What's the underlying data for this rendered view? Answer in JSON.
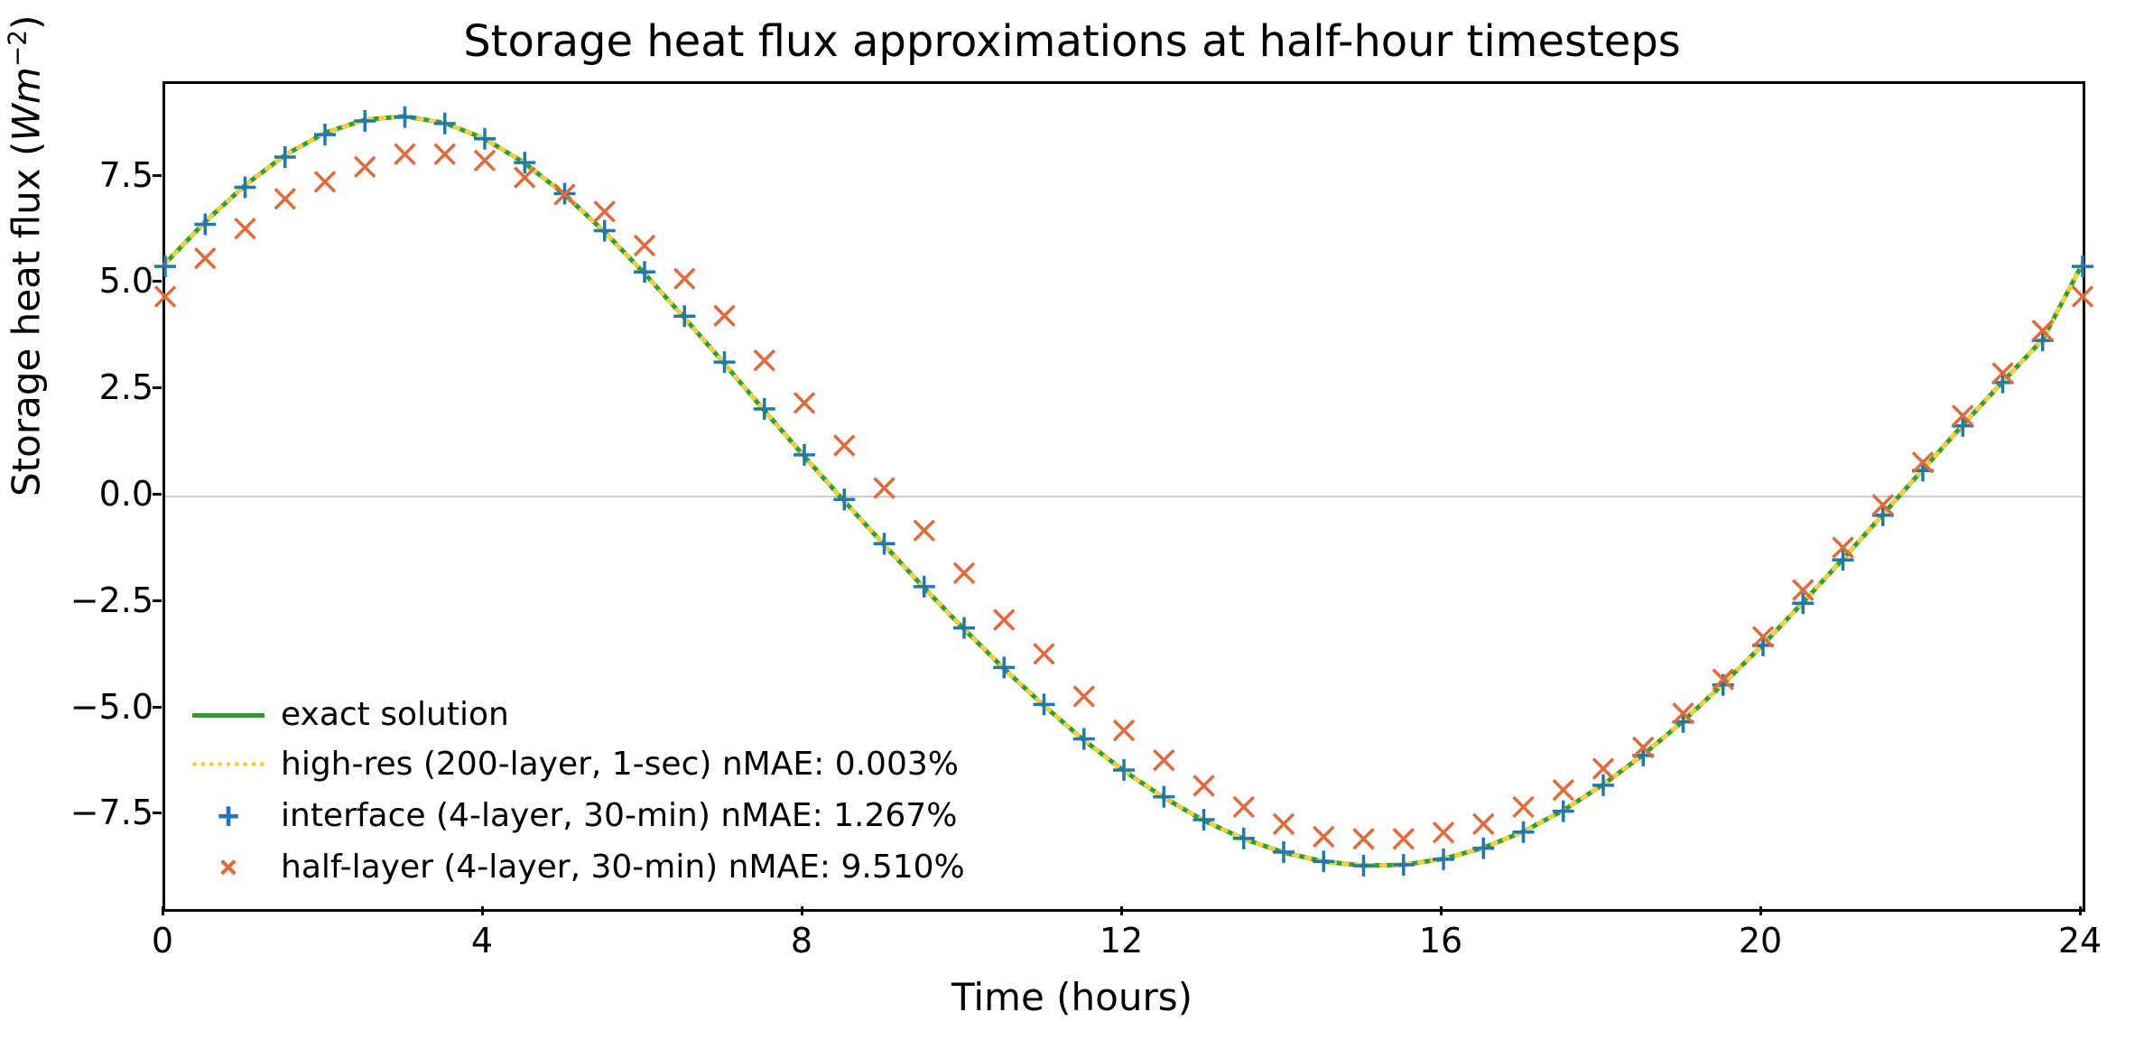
{
  "chart_data": {
    "type": "line",
    "title": "Storage heat flux approximations at half-hour timesteps",
    "xlabel": "Time (hours)",
    "ylabel_html": "Storage heat flux (<span class='mi'>Wm</span><span class='sup'>−2</span>)",
    "xlim": [
      0,
      24
    ],
    "ylim": [
      -9.7,
      9.7
    ],
    "xticks": [
      0,
      4,
      8,
      12,
      16,
      20,
      24
    ],
    "yticks": [
      -7.5,
      -5.0,
      -2.5,
      0.0,
      2.5,
      5.0,
      7.5
    ],
    "ytick_labels": [
      "−7.5",
      "−5.0",
      "−2.5",
      "0.0",
      "2.5",
      "5.0",
      "7.5"
    ],
    "legend_pos": "lower left",
    "series": [
      {
        "name": "exact solution",
        "style": "solid",
        "color": "#2ca02c",
        "smooth": true,
        "x": [
          0,
          0.5,
          1,
          1.5,
          2,
          2.5,
          3,
          3.5,
          4,
          4.5,
          5,
          5.5,
          6,
          6.5,
          7,
          7.5,
          8,
          8.5,
          9,
          9.5,
          10,
          10.5,
          11,
          11.5,
          12,
          12.5,
          13,
          13.5,
          14,
          14.5,
          15,
          15.5,
          16,
          16.5,
          17,
          17.5,
          18,
          18.5,
          19,
          19.5,
          20,
          20.5,
          21,
          21.5,
          22,
          22.5,
          23,
          23.5,
          24
        ],
        "values": [
          5.48,
          6.46,
          7.32,
          8.03,
          8.55,
          8.86,
          8.94,
          8.78,
          8.41,
          7.84,
          7.1,
          6.22,
          5.24,
          4.2,
          3.12,
          2.02,
          0.94,
          -0.11,
          -1.14,
          -2.15,
          -3.12,
          -4.05,
          -4.92,
          -5.73,
          -6.45,
          -7.08,
          -7.62,
          -8.05,
          -8.37,
          -8.58,
          -8.68,
          -8.66,
          -8.52,
          -8.26,
          -7.88,
          -7.38,
          -6.77,
          -6.07,
          -5.28,
          -4.41,
          -3.48,
          -2.49,
          -1.47,
          -0.42,
          0.63,
          1.68,
          2.7,
          3.69,
          5.48
        ]
      },
      {
        "name": "high-res (200-layer, 1-sec)  nMAE: 0.003%",
        "style": "dotted",
        "color": "#f4d13a",
        "smooth": true,
        "x": [
          0,
          0.5,
          1,
          1.5,
          2,
          2.5,
          3,
          3.5,
          4,
          4.5,
          5,
          5.5,
          6,
          6.5,
          7,
          7.5,
          8,
          8.5,
          9,
          9.5,
          10,
          10.5,
          11,
          11.5,
          12,
          12.5,
          13,
          13.5,
          14,
          14.5,
          15,
          15.5,
          16,
          16.5,
          17,
          17.5,
          18,
          18.5,
          19,
          19.5,
          20,
          20.5,
          21,
          21.5,
          22,
          22.5,
          23,
          23.5,
          24
        ],
        "values": [
          5.48,
          6.46,
          7.32,
          8.03,
          8.55,
          8.86,
          8.94,
          8.78,
          8.41,
          7.84,
          7.1,
          6.22,
          5.24,
          4.2,
          3.12,
          2.02,
          0.94,
          -0.11,
          -1.14,
          -2.15,
          -3.12,
          -4.05,
          -4.92,
          -5.73,
          -6.45,
          -7.08,
          -7.62,
          -8.05,
          -8.37,
          -8.58,
          -8.68,
          -8.66,
          -8.52,
          -8.26,
          -7.88,
          -7.38,
          -6.77,
          -6.07,
          -5.28,
          -4.41,
          -3.48,
          -2.49,
          -1.47,
          -0.42,
          0.63,
          1.68,
          2.7,
          3.69,
          5.48
        ]
      },
      {
        "name": "interface (4-layer, 30-min)   nMAE: 1.267%",
        "style": "plus",
        "color": "#1f77b4",
        "x": [
          0,
          0.5,
          1,
          1.5,
          2,
          2.5,
          3,
          3.5,
          4,
          4.5,
          5,
          5.5,
          6,
          6.5,
          7,
          7.5,
          8,
          8.5,
          9,
          9.5,
          10,
          10.5,
          11,
          11.5,
          12,
          12.5,
          13,
          13.5,
          14,
          14.5,
          15,
          15.5,
          16,
          16.5,
          17,
          17.5,
          18,
          18.5,
          19,
          19.5,
          20,
          20.5,
          21,
          21.5,
          22,
          22.5,
          23,
          23.5,
          24
        ],
        "values": [
          5.41,
          6.4,
          7.27,
          7.98,
          8.51,
          8.83,
          8.92,
          8.77,
          8.41,
          7.85,
          7.12,
          6.25,
          5.28,
          4.24,
          3.16,
          2.06,
          0.98,
          -0.07,
          -1.11,
          -2.12,
          -3.09,
          -4.02,
          -4.89,
          -5.7,
          -6.43,
          -7.06,
          -7.6,
          -8.04,
          -8.36,
          -8.58,
          -8.68,
          -8.66,
          -8.53,
          -8.27,
          -7.89,
          -7.4,
          -6.79,
          -6.09,
          -5.3,
          -4.43,
          -3.5,
          -2.51,
          -1.49,
          -0.44,
          0.61,
          1.66,
          2.68,
          3.67,
          5.41
        ]
      },
      {
        "name": "half-layer (4-layer, 30-min) nMAE: 9.510%",
        "style": "cross",
        "color": "#e06a3a",
        "x": [
          0,
          0.5,
          1,
          1.5,
          2,
          2.5,
          3,
          3.5,
          4,
          4.5,
          5,
          5.5,
          6,
          6.5,
          7,
          7.5,
          8,
          8.5,
          9,
          9.5,
          10,
          10.5,
          11,
          11.5,
          12,
          12.5,
          13,
          13.5,
          14,
          14.5,
          15,
          15.5,
          16,
          16.5,
          17,
          17.5,
          18,
          18.5,
          19,
          19.5,
          20,
          20.5,
          21,
          21.5,
          22,
          22.5,
          23,
          23.5,
          24
        ],
        "values": [
          4.7,
          5.6,
          6.3,
          7.0,
          7.4,
          7.75,
          8.05,
          8.05,
          7.9,
          7.5,
          7.1,
          6.7,
          5.9,
          5.12,
          4.25,
          3.2,
          2.2,
          1.2,
          0.2,
          -0.8,
          -1.8,
          -2.9,
          -3.7,
          -4.7,
          -5.5,
          -6.2,
          -6.8,
          -7.3,
          -7.7,
          -8.0,
          -8.05,
          -8.05,
          -7.9,
          -7.7,
          -7.3,
          -6.9,
          -6.4,
          -5.9,
          -5.1,
          -4.3,
          -3.3,
          -2.2,
          -1.2,
          -0.2,
          0.8,
          1.9,
          2.9,
          3.9,
          4.7
        ]
      }
    ]
  }
}
